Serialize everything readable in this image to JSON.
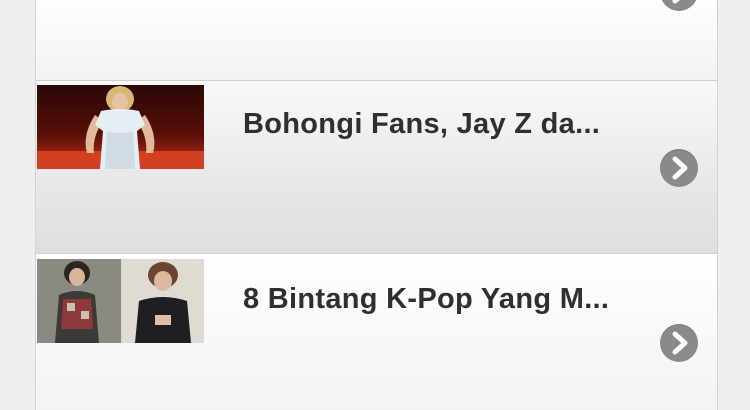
{
  "list": {
    "items": [
      {
        "title": "",
        "thumbnail": "",
        "arrow_icon": "chevron-right-icon"
      },
      {
        "title": "Bohongi Fans, Jay Z da...",
        "thumbnail": "woman-in-white-dress-photo",
        "arrow_icon": "chevron-right-icon"
      },
      {
        "title": "8 Bintang K-Pop Yang M...",
        "thumbnail": "two-kpop-stars-photo",
        "arrow_icon": "chevron-right-icon"
      }
    ]
  },
  "colors": {
    "arrow_bg": "#8a8a8a",
    "title_text": "#2f2f2f",
    "row_border": "#cfcfcf"
  }
}
